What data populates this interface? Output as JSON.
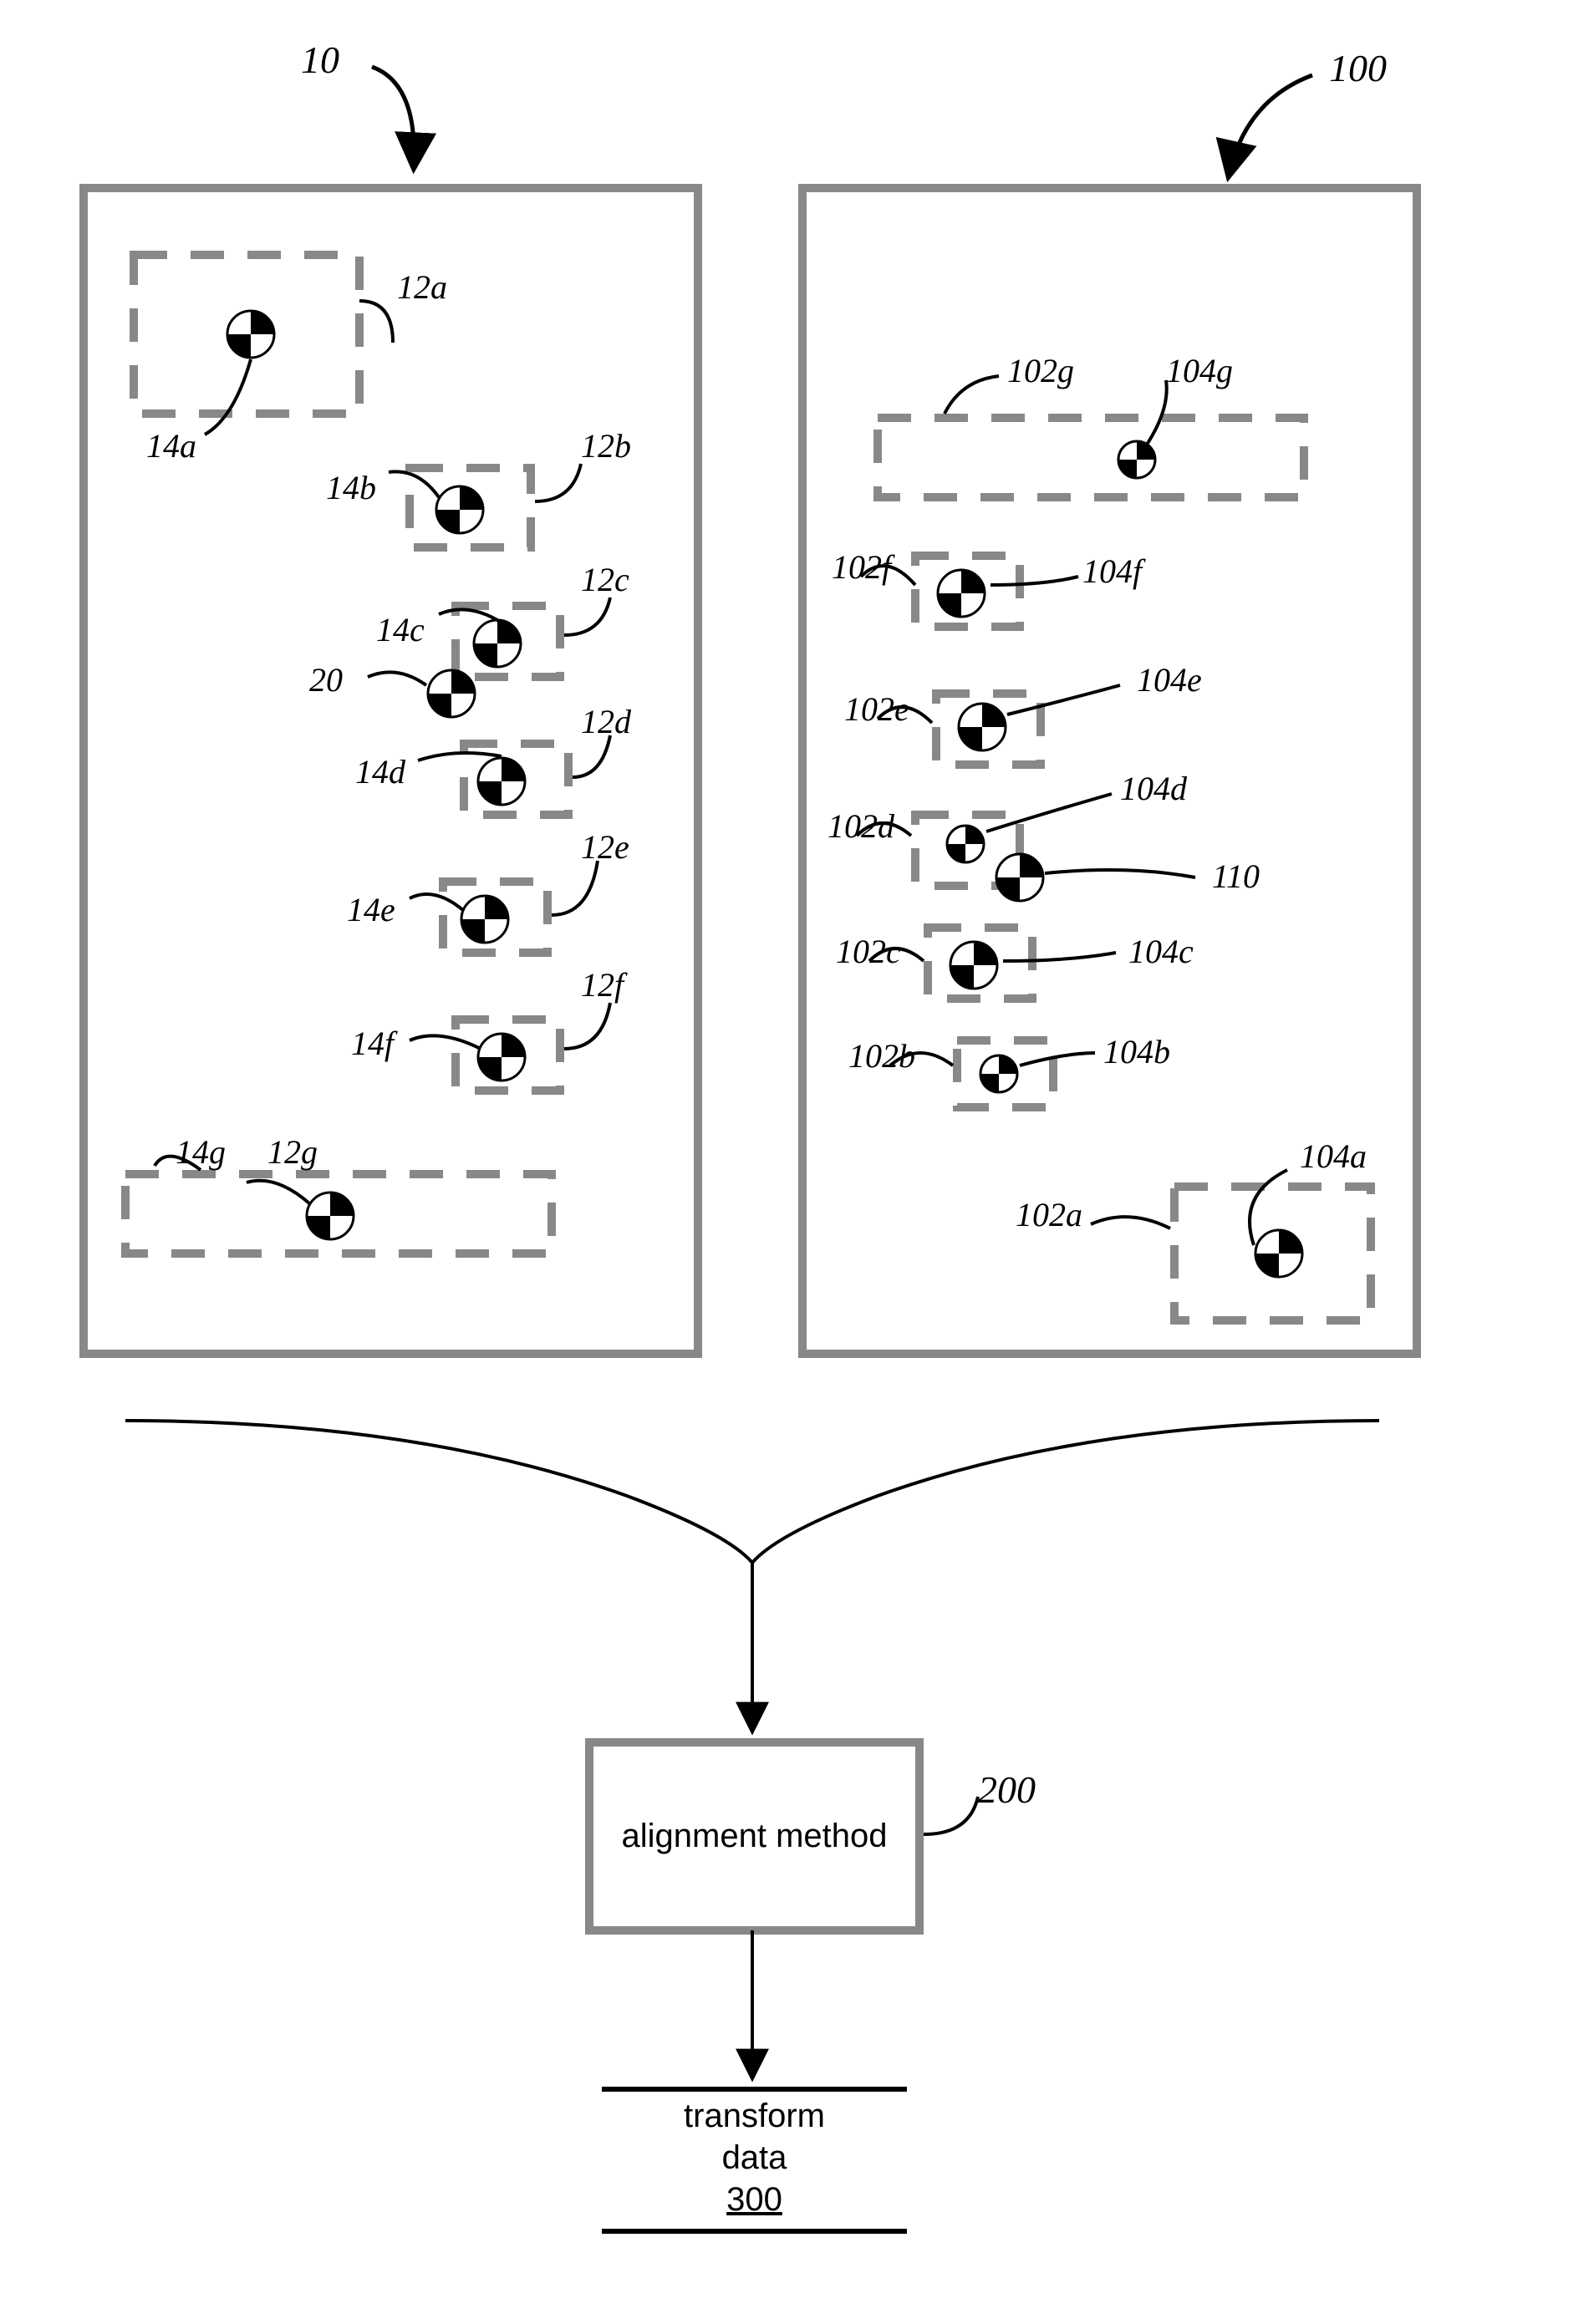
{
  "labels": {
    "panel_left": "10",
    "panel_right": "100",
    "l12a": "12a",
    "l12b": "12b",
    "l12c": "12c",
    "l12d": "12d",
    "l12e": "12e",
    "l12f": "12f",
    "l12g": "12g",
    "l14a": "14a",
    "l14b": "14b",
    "l14c": "14c",
    "l14d": "14d",
    "l14e": "14e",
    "l14f": "14f",
    "l14g": "14g",
    "l20": "20",
    "l102a": "102a",
    "l102b": "102b",
    "l102c": "102c",
    "l102d": "102d",
    "l102e": "102e",
    "l102f": "102f",
    "l102g": "102g",
    "l104a": "104a",
    "l104b": "104b",
    "l104c": "104c",
    "l104d": "104d",
    "l104e": "104e",
    "l104f": "104f",
    "l104g": "104g",
    "l110": "110",
    "process_box": "200",
    "process_text": "alignment method",
    "output_l1": "transform",
    "output_l2": "data",
    "output_ref": "300"
  },
  "structure": {
    "left_panel": {
      "ref": "10",
      "regions": [
        "12a",
        "12b",
        "12c",
        "12d",
        "12e",
        "12f",
        "12g"
      ],
      "centroids": [
        "14a",
        "14b",
        "14c",
        "14d",
        "14e",
        "14f",
        "14g"
      ],
      "extra_centroid": "20"
    },
    "right_panel": {
      "ref": "100",
      "regions": [
        "102a",
        "102b",
        "102c",
        "102d",
        "102e",
        "102f",
        "102g"
      ],
      "centroids": [
        "104a",
        "104b",
        "104c",
        "104d",
        "104e",
        "104f",
        "104g"
      ],
      "extra_centroid": "110"
    },
    "process": {
      "ref": "200",
      "label": "alignment method"
    },
    "output": {
      "ref": "300",
      "label": "transform data"
    }
  }
}
